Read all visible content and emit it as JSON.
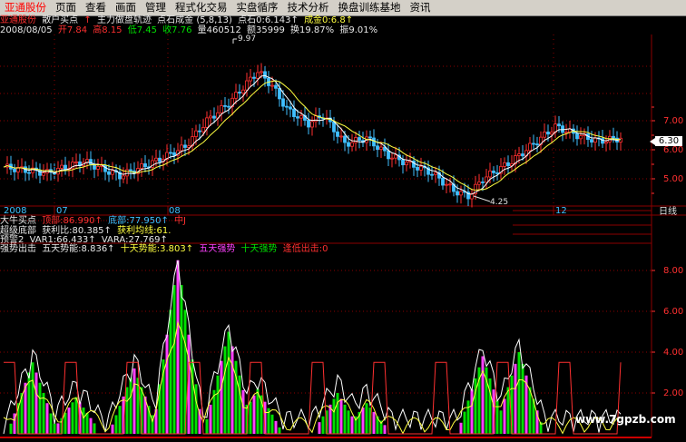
{
  "menu": [
    "亚通股份",
    "页面",
    "查看",
    "画面",
    "管理",
    "程式化交易",
    "实盘循序",
    "技术分析",
    "换盘训练基地",
    "资讯"
  ],
  "info1": {
    "stock": "亚通股份",
    "ind1": "散户买点",
    "ind2": "主力做盘轨迹",
    "ind3": "点石成金 (5,8,13)",
    "ind4": "点石0:6.143↑",
    "ind5": "成金0:6.8↑"
  },
  "info2": {
    "date": "2008/08/05",
    "open": "开7.84",
    "high": "高8.15",
    "low": "低7.45",
    "close": "收7.76",
    "vol": "量460512",
    "amount": "额35999",
    "turnover": "换19.87%",
    "amplitude": "振9.01%"
  },
  "main_axis": [
    "7.00",
    "6.00",
    "5.00"
  ],
  "main_high_label": "9.97",
  "main_low_label": "4.25",
  "price_tag": "6.30",
  "timeline": {
    "y2008": "2008",
    "m07": "07",
    "m08": "08",
    "m12": "12",
    "period": "日线"
  },
  "panel_labels": {
    "l1": "大牛买点",
    "l1v": "顶部:86.990↑",
    "l1v2": "底部:77.950↑",
    "l1v3": "中J",
    "l2": "超级底部",
    "l2v": "获利比:80.385↑",
    "l2v2": "获利均线:61.",
    "l3": "预警2",
    "l3v": "VAR1:66.433↑",
    "l3v2": "VARA:27.769↑",
    "l4": "强势出击",
    "l4a": "五天势能:8.836↑",
    "l4b": "十天势能:3.803↑",
    "l4c": "五天强势",
    "l4d": "十天强势",
    "l4e": "逢低出击:0"
  },
  "sub_axis": [
    "8.00",
    "6.00",
    "4.00",
    "2.00"
  ],
  "watermark": "www.7gpzb.com",
  "colors": {
    "up": "#ff3030",
    "down": "#40c0ff",
    "ma1": "#ffffff",
    "ma2": "#ffff40",
    "grid": "#8b0000"
  }
}
